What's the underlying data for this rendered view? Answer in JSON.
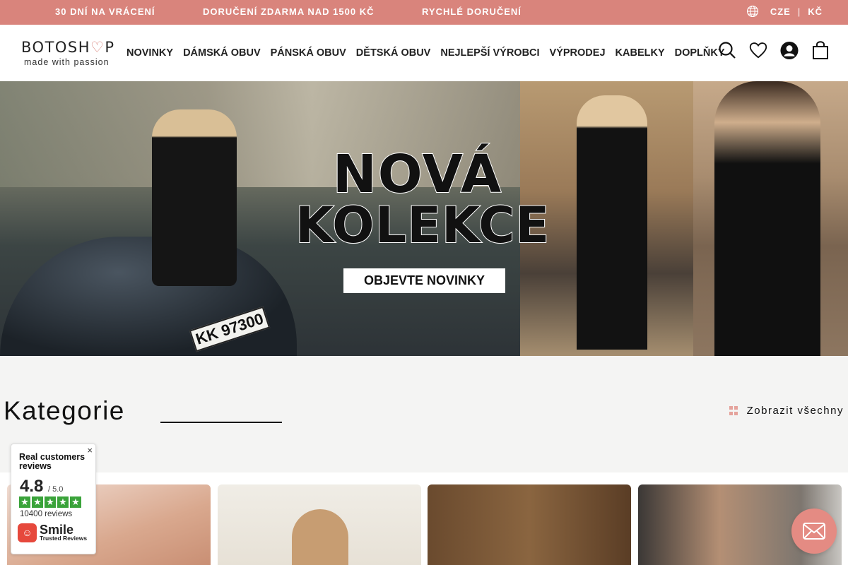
{
  "topbar": {
    "promos": [
      "30 DNÍ NA VRÁCENÍ",
      "DORUČENÍ ZDARMA NAD 1500 KČ",
      "RYCHLÉ DORUČENÍ"
    ],
    "language": "CZE",
    "separator": "|",
    "currency": "KČ",
    "icons": {
      "language": "globe-icon"
    }
  },
  "header": {
    "logo_main": "BOTOSHOP",
    "logo_sub": "made with passion",
    "nav": [
      "NOVINKY",
      "DÁMSKÁ OBUV",
      "PÁNSKÁ OBUV",
      "DĚTSKÁ OBUV",
      "NEJLEPŠÍ VÝROBCI",
      "VÝPRODEJ",
      "KABELKY",
      "DOPLŇKY"
    ],
    "icons": [
      "search-icon",
      "heart-icon",
      "account-icon",
      "cart-icon"
    ]
  },
  "hero": {
    "title_line1": "NOVÁ",
    "title_line2": "KOLEKCE",
    "button": "OBJEVTE NOVINKY",
    "plate_text": "KK 97300"
  },
  "categories": {
    "title": "Kategorie",
    "show_all": "Zobrazit všechny"
  },
  "reviews_widget": {
    "title": "Real customers reviews",
    "score": "4.8",
    "out_of": "/ 5.0",
    "stars": 5,
    "count": "10400 reviews",
    "brand": "Smile",
    "brand_sub": "Trusted Reviews",
    "close": "×"
  },
  "colors": {
    "accent": "#d9847c",
    "chat": "#e48b83",
    "stars": "#3aa33a"
  }
}
